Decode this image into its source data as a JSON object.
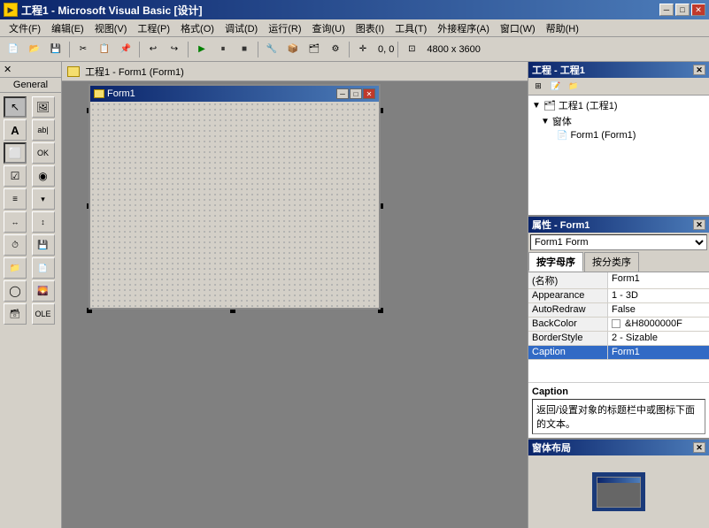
{
  "titlebar": {
    "title": "工程1 - Microsoft Visual Basic [设计]",
    "icon": "VB",
    "min_btn": "─",
    "max_btn": "□",
    "close_btn": "✕"
  },
  "menubar": {
    "items": [
      {
        "label": "文件(F)"
      },
      {
        "label": "编辑(E)"
      },
      {
        "label": "视图(V)"
      },
      {
        "label": "工程(P)"
      },
      {
        "label": "格式(O)"
      },
      {
        "label": "调试(D)"
      },
      {
        "label": "运行(R)"
      },
      {
        "label": "查询(U)"
      },
      {
        "label": "图表(I)"
      },
      {
        "label": "工具(T)"
      },
      {
        "label": "外接程序(A)"
      },
      {
        "label": "窗口(W)"
      },
      {
        "label": "帮助(H)"
      }
    ]
  },
  "toolbar": {
    "coord_label": "0, 0",
    "size_label": "4800 x 3600"
  },
  "toolbox": {
    "header_label": "General",
    "tools": [
      {
        "name": "pointer",
        "icon": "↖"
      },
      {
        "name": "picture",
        "icon": "🖼"
      },
      {
        "name": "label",
        "icon": "A"
      },
      {
        "name": "textbox",
        "icon": "ab|"
      },
      {
        "name": "frame",
        "icon": "⬜"
      },
      {
        "name": "line",
        "icon": "╱"
      },
      {
        "name": "checkbox",
        "icon": "☑"
      },
      {
        "name": "optionbtn",
        "icon": "⊙"
      },
      {
        "name": "listbox",
        "icon": "≡"
      },
      {
        "name": "combobox",
        "icon": "▾"
      },
      {
        "name": "hscroll",
        "icon": "↔"
      },
      {
        "name": "vscroll",
        "icon": "↕"
      },
      {
        "name": "timer",
        "icon": "⏱"
      },
      {
        "name": "drive",
        "icon": "💾"
      },
      {
        "name": "dirlist",
        "icon": "📁"
      },
      {
        "name": "filelist",
        "icon": "📄"
      },
      {
        "name": "shape",
        "icon": "◯"
      },
      {
        "name": "image",
        "icon": "🌄"
      },
      {
        "name": "data",
        "icon": "🗃"
      },
      {
        "name": "ole",
        "icon": "📦"
      }
    ]
  },
  "designer": {
    "caption": "工程1 - Form1 (Form1)",
    "form_title": "Form1",
    "form_min": "─",
    "form_max": "□",
    "form_close": "✕"
  },
  "project_panel": {
    "title": "工程 - 工程1",
    "toolbar_btns": [
      "⊞",
      "🗂",
      "📄"
    ],
    "tree": [
      {
        "indent": 0,
        "icon": "▼",
        "extra": "🗂",
        "text": "工程1 (工程1)"
      },
      {
        "indent": 1,
        "icon": "▼",
        "extra": "",
        "text": "窗体"
      },
      {
        "indent": 2,
        "icon": "",
        "extra": "📄",
        "text": "Form1 (Form1)"
      }
    ]
  },
  "properties_panel": {
    "title": "属性 - Form1",
    "selector_value": "Form1 Form",
    "tab_alpha": "按字母序",
    "tab_category": "按分类序",
    "rows": [
      {
        "key": "(名称)",
        "value": "Form1",
        "selected": false
      },
      {
        "key": "Appearance",
        "value": "1 - 3D",
        "selected": false
      },
      {
        "key": "AutoRedraw",
        "value": "False",
        "selected": false
      },
      {
        "key": "BackColor",
        "value": "□ &H8000000F",
        "selected": false
      },
      {
        "key": "BorderStyle",
        "value": "2 - Sizable",
        "selected": false
      },
      {
        "key": "Caption",
        "value": "Form1",
        "selected": true
      }
    ],
    "caption_title": "Caption",
    "caption_desc": "返回/设置对象的标题栏中或图标下面的文本。"
  },
  "layout_panel": {
    "title": "窗体布局"
  }
}
